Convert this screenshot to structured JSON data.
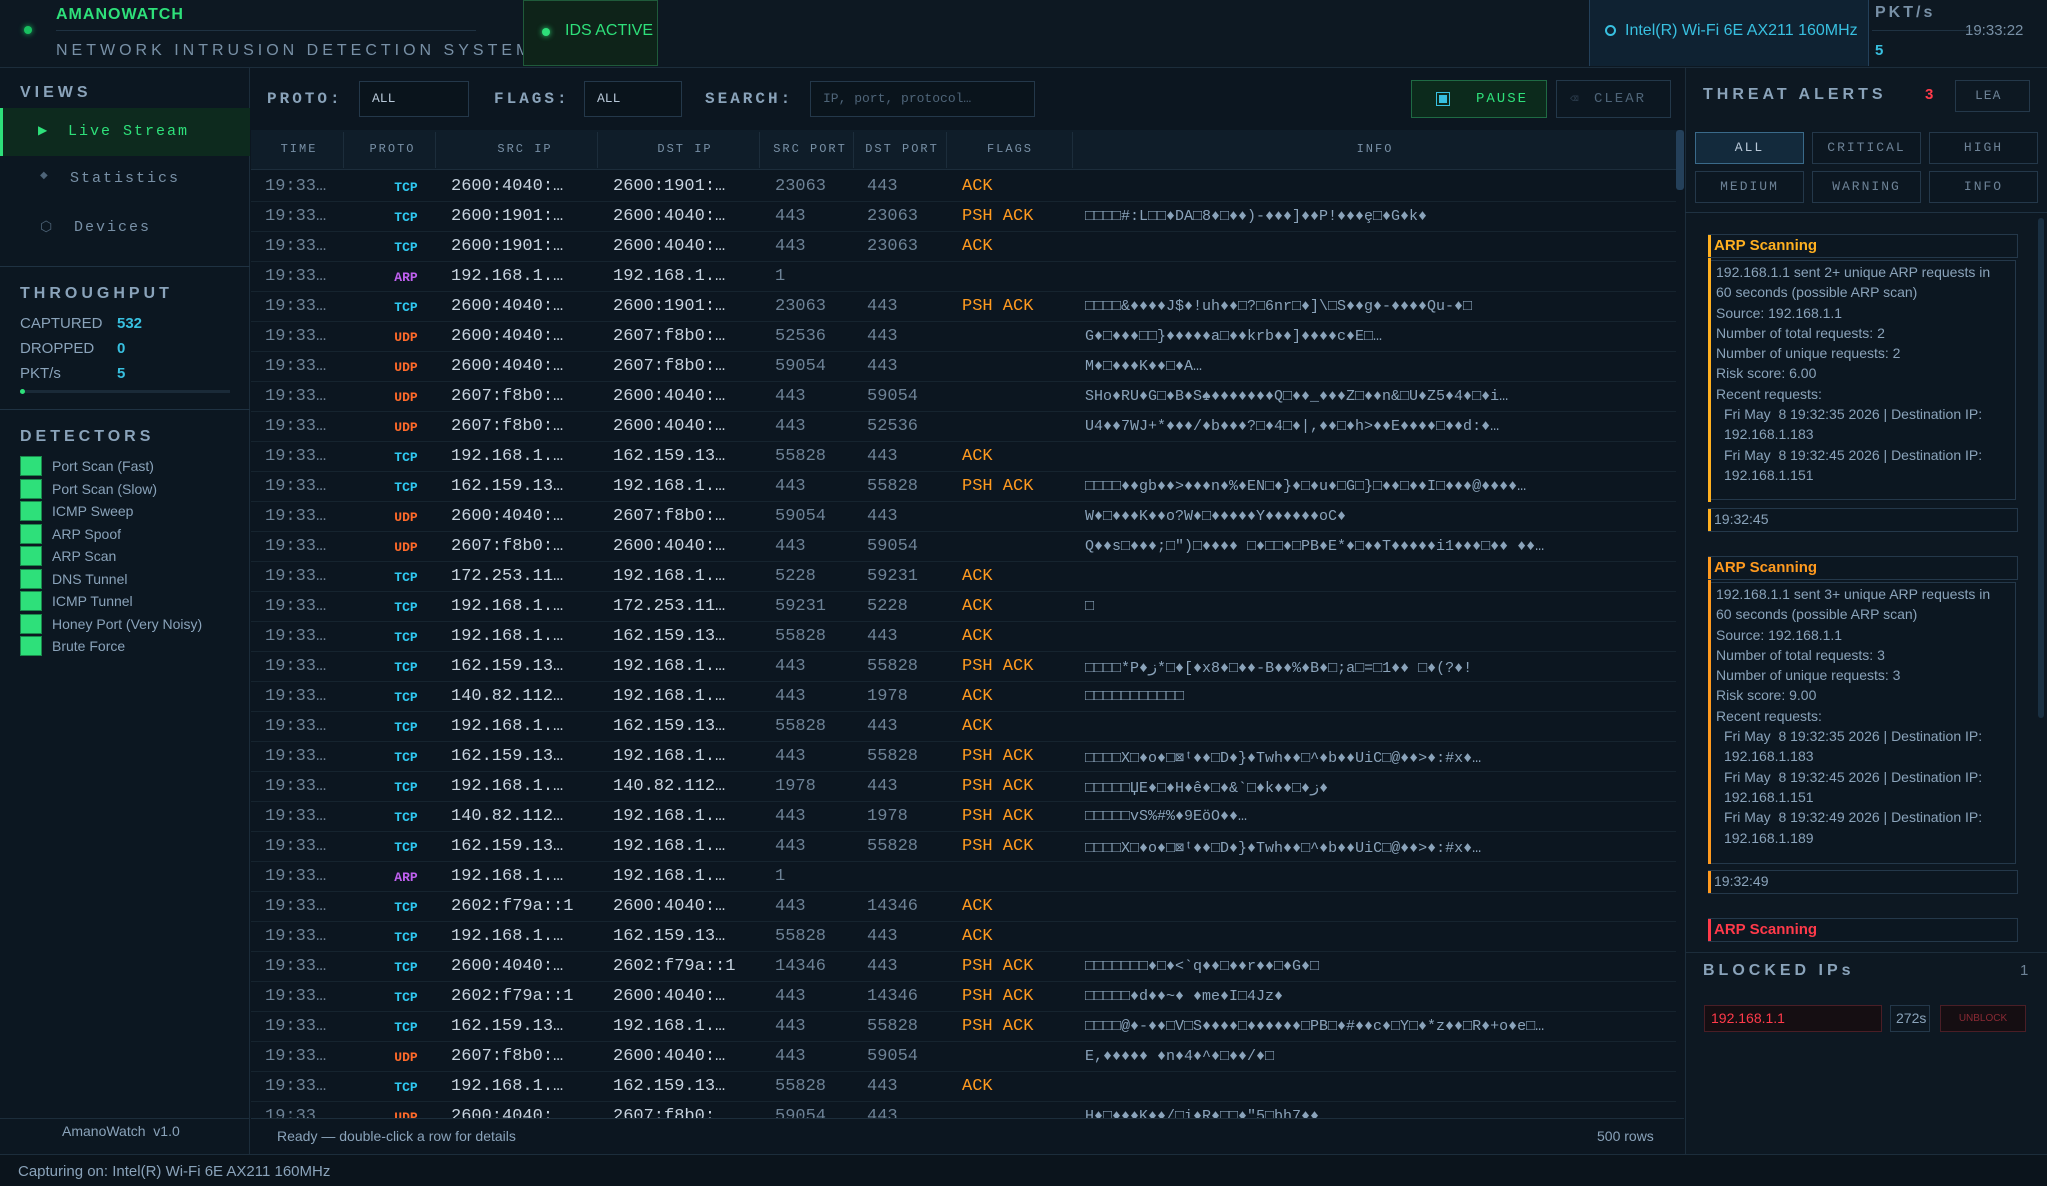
{
  "header": {
    "title": "AMANOWATCH",
    "subtitle": "NETWORK INTRUSION DETECTION SYSTEM",
    "ids_status": "IDS ACTIVE",
    "interface": "Intel(R) Wi-Fi 6E AX211 160MHz",
    "pkts_title": "PKT/s",
    "pkts_value": "5",
    "clock": "19:33:22"
  },
  "sidebar": {
    "views_title": "VIEWS",
    "views": [
      {
        "label": "Live Stream",
        "icon": "▶"
      },
      {
        "label": "Statistics",
        "icon": "◆"
      },
      {
        "label": "Devices",
        "icon": "⬡"
      }
    ],
    "throughput_title": "THROUGHPUT",
    "throughput": [
      {
        "label": "CAPTURED",
        "value": "532"
      },
      {
        "label": "DROPPED",
        "value": "0"
      },
      {
        "label": "PKT/s",
        "value": "5"
      }
    ],
    "detectors_title": "DETECTORS",
    "detectors": [
      "Port Scan (Fast)",
      "Port Scan (Slow)",
      "ICMP Sweep",
      "ARP Spoof",
      "ARP Scan",
      "DNS Tunnel",
      "ICMP Tunnel",
      "Honey Port (Very Noisy)",
      "Brute Force"
    ],
    "footer": "AmanoWatch  v1.0"
  },
  "filters": {
    "proto_label": "PROTO:",
    "proto_value": "ALL",
    "flags_label": "FLAGS:",
    "flags_value": "ALL",
    "search_label": "SEARCH:",
    "search_placeholder": "IP, port, protocol…",
    "pause_label": "PAUSE",
    "clear_label": "CLEAR"
  },
  "table": {
    "columns": [
      "TIME",
      "PROTO",
      "SRC IP",
      "DST IP",
      "SRC PORT",
      "DST PORT",
      "FLAGS",
      "INFO"
    ],
    "rows": [
      [
        "19:33…",
        "TCP",
        "2600:4040:…",
        "2600:1901:…",
        "23063",
        "443",
        "ACK",
        ""
      ],
      [
        "19:33…",
        "TCP",
        "2600:1901:…",
        "2600:4040:…",
        "443",
        "23063",
        "PSH ACK",
        "□□□□#:L□□♦DA□8♦□♦♦)-♦♦♦]♦♦P!♦♦♦ȩ□♦G♦k♦"
      ],
      [
        "19:33…",
        "TCP",
        "2600:1901:…",
        "2600:4040:…",
        "443",
        "23063",
        "ACK",
        ""
      ],
      [
        "19:33…",
        "ARP",
        "192.168.1.…",
        "192.168.1.…",
        "1",
        "",
        "",
        ""
      ],
      [
        "19:33…",
        "TCP",
        "2600:4040:…",
        "2600:1901:…",
        "23063",
        "443",
        "PSH ACK",
        "□□□□&♦♦♦♦J$♦!uh♦♦□?□6nr□♦]\\□S♦♦g♦-♦♦♦♦Qu-♦□"
      ],
      [
        "19:33…",
        "UDP",
        "2600:4040:…",
        "2607:f8b0:…",
        "52536",
        "443",
        "",
        "G♦□♦♦♦□□}♦♦♦♦♦a□♦♦krb♦♦]♦♦♦♦c♦E□…"
      ],
      [
        "19:33…",
        "UDP",
        "2600:4040:…",
        "2607:f8b0:…",
        "59054",
        "443",
        "",
        "M♦□♦♦♦K♦♦□♦A…"
      ],
      [
        "19:33…",
        "UDP",
        "2607:f8b0:…",
        "2600:4040:…",
        "443",
        "59054",
        "",
        "SHo♦RU♦G□♦B♦S♠♦♦♦♦♦♦♦Q□♦♦_♦♦♦Z□♦♦n&□U♦Z5♦4♦□♦i…"
      ],
      [
        "19:33…",
        "UDP",
        "2607:f8b0:…",
        "2600:4040:…",
        "443",
        "52536",
        "",
        "U4♦♦7WJ+*♦♦♦/♦b♦♦♦?□♦4□♦|,♦♦□♦h>♦♦E♦♦♦♦□♦♦d:♦…"
      ],
      [
        "19:33…",
        "TCP",
        "192.168.1.…",
        "162.159.13…",
        "55828",
        "443",
        "ACK",
        ""
      ],
      [
        "19:33…",
        "TCP",
        "162.159.13…",
        "192.168.1.…",
        "443",
        "55828",
        "PSH ACK",
        "□□□□♦♦gb♦♦>♦♦♦n♦%♦EN□♦}♦□♦u♦□G□}□♦♦□♦♦I□♦♦♦@♦♦♦♦…"
      ],
      [
        "19:33…",
        "UDP",
        "2600:4040:…",
        "2607:f8b0:…",
        "59054",
        "443",
        "",
        "W♦□♦♦♦K♦♦o?W♦□♦♦♦♦♦Y♦♦♦♦♦♦oC♦"
      ],
      [
        "19:33…",
        "UDP",
        "2607:f8b0:…",
        "2600:4040:…",
        "443",
        "59054",
        "",
        "Q♦♦s□♦♦♦;□\")□♦♦♦♦ □♦□□♦□PB♦E*♦□♦♦T♦♦♦♦♦i1♦♦♦□♦♦ ♦♦…"
      ],
      [
        "19:33…",
        "TCP",
        "172.253.11…",
        "192.168.1.…",
        "5228",
        "59231",
        "ACK",
        ""
      ],
      [
        "19:33…",
        "TCP",
        "192.168.1.…",
        "172.253.11…",
        "59231",
        "5228",
        "ACK",
        "□"
      ],
      [
        "19:33…",
        "TCP",
        "192.168.1.…",
        "162.159.13…",
        "55828",
        "443",
        "ACK",
        ""
      ],
      [
        "19:33…",
        "TCP",
        "162.159.13…",
        "192.168.1.…",
        "443",
        "55828",
        "PSH ACK",
        "□□□□*P♦ز*□♦[♦x8♦□♦♦-B♦♦%♦B♦□;a□=□1♦♦       □♦(?♦!"
      ],
      [
        "19:33…",
        "TCP",
        "140.82.112…",
        "192.168.1.…",
        "443",
        "1978",
        "ACK",
        "□□□□□□□□□□□"
      ],
      [
        "19:33…",
        "TCP",
        "192.168.1.…",
        "162.159.13…",
        "55828",
        "443",
        "ACK",
        ""
      ],
      [
        "19:33…",
        "TCP",
        "162.159.13…",
        "192.168.1.…",
        "443",
        "55828",
        "PSH ACK",
        "□□□□X□♦o♦□⊠ᵗ♦♦□D♦}♦Twh♦♦□^♦b♦♦UiC□@♦♦>♦:#x♦…"
      ],
      [
        "19:33…",
        "TCP",
        "192.168.1.…",
        "140.82.112…",
        "1978",
        "443",
        "PSH ACK",
        "□□□□□ЏE♦□♦H♦ê♦□♦&`□♦k♦♦□♦ز♦"
      ],
      [
        "19:33…",
        "TCP",
        "140.82.112…",
        "192.168.1.…",
        "443",
        "1978",
        "PSH ACK",
        "□□□□□vS%#%♦9EöO♦♦…"
      ],
      [
        "19:33…",
        "TCP",
        "162.159.13…",
        "192.168.1.…",
        "443",
        "55828",
        "PSH ACK",
        "□□□□X□♦o♦□⊠ᵗ♦♦□D♦}♦Twh♦♦□^♦b♦♦UiC□@♦♦>♦:#x♦…"
      ],
      [
        "19:33…",
        "ARP",
        "192.168.1.…",
        "192.168.1.…",
        "1",
        "",
        "",
        ""
      ],
      [
        "19:33…",
        "TCP",
        "2602:f79a::1",
        "2600:4040:…",
        "443",
        "14346",
        "ACK",
        ""
      ],
      [
        "19:33…",
        "TCP",
        "192.168.1.…",
        "162.159.13…",
        "55828",
        "443",
        "ACK",
        ""
      ],
      [
        "19:33…",
        "TCP",
        "2600:4040:…",
        "2602:f79a::1",
        "14346",
        "443",
        "PSH ACK",
        "□□□□□□□♦□♦<`q♦♦□♦♦r♦♦□♦G♦□"
      ],
      [
        "19:33…",
        "TCP",
        "2602:f79a::1",
        "2600:4040:…",
        "443",
        "14346",
        "PSH ACK",
        "□□□□□♦d♦♦~♦ ♦me♦I□4Jz♦"
      ],
      [
        "19:33…",
        "TCP",
        "162.159.13…",
        "192.168.1.…",
        "443",
        "55828",
        "PSH ACK",
        "□□□□@♦-♦♦□V□S♦♦♦♦□♦♦♦♦♦♦□PB□♦#♦♦c♦□Y□♦*z♦♦□R♦+o♦e□…"
      ],
      [
        "19:33…",
        "UDP",
        "2607:f8b0:…",
        "2600:4040:…",
        "443",
        "59054",
        "",
        "E,♦♦♦♦♦  ♦n♦4♦^♦□♦♦/♦□"
      ],
      [
        "19:33…",
        "TCP",
        "192.168.1.…",
        "162.159.13…",
        "55828",
        "443",
        "ACK",
        ""
      ],
      [
        "19:33…",
        "UDP",
        "2600:4040:…",
        "2607:f8b0:…",
        "59054",
        "443",
        "",
        "H♦□♦♦♦K♦♦/□i♦R♦□□♦\"5□bh7♦♦"
      ]
    ]
  },
  "status": {
    "message": "Ready — double-click a row for details",
    "row_count": "500 rows",
    "capture": "Capturing on: Intel(R) Wi-Fi 6E AX211 160MHz"
  },
  "alerts": {
    "title": "THREAT ALERTS",
    "count": "3",
    "clear_label": "LEA",
    "filters": [
      "ALL",
      "CRITICAL",
      "HIGH",
      "MEDIUM",
      "WARNING",
      "INFO"
    ],
    "items": [
      {
        "title": "ARP Scanning",
        "lines": [
          "192.168.1.1 sent 2+ unique ARP requests in",
          "60 seconds (possible ARP scan)",
          "Source: 192.168.1.1",
          "Number of total requests: 2",
          "Number of unique requests: 2",
          "Risk score: 6.00",
          "Recent requests:"
        ],
        "requests": [
          "Fri May  8 19:32:35 2026 | Destination IP:",
          "192.168.1.183",
          "Fri May  8 19:32:45 2026 | Destination IP:",
          "192.168.1.151"
        ],
        "time": "19:32:45"
      },
      {
        "title": "ARP Scanning",
        "lines": [
          "192.168.1.1 sent 3+ unique ARP requests in",
          "60 seconds (possible ARP scan)",
          "Source: 192.168.1.1",
          "Number of total requests: 3",
          "Number of unique requests: 3",
          "Risk score: 9.00",
          "Recent requests:"
        ],
        "requests": [
          "Fri May  8 19:32:35 2026 | Destination IP:",
          "192.168.1.183",
          "Fri May  8 19:32:45 2026 | Destination IP:",
          "192.168.1.151",
          "Fri May  8 19:32:49 2026 | Destination IP:",
          "192.168.1.189"
        ],
        "time": "19:32:49"
      },
      {
        "title": "ARP Scanning"
      }
    ]
  },
  "blocked": {
    "title": "BLOCKED IPs",
    "count": "1",
    "ip": "192.168.1.1",
    "ttl": "272s",
    "unblock_label": "UNBLOCK"
  },
  "colors": {
    "accent": "#2ee07a",
    "cyan": "#38c0e0",
    "warning": "#ffb020",
    "critical": "#ff3a4a",
    "tcp": "#2ec8f0",
    "udp": "#ff6a2a",
    "arp": "#c060f0"
  }
}
